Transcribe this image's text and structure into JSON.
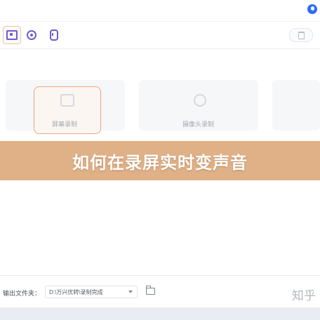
{
  "banner": {
    "title": "如何在录屏实时变声音"
  },
  "toolbar": {
    "buttons": [
      {
        "icon": "screen-record-icon",
        "active": true
      },
      {
        "icon": "webcam-icon",
        "active": false
      },
      {
        "icon": "microphone-icon",
        "active": false
      }
    ],
    "right_icon": "trash-icon"
  },
  "modes": [
    {
      "label": "屏幕录制",
      "icon": "screen-record-icon"
    },
    {
      "label": "摄像头录制",
      "icon": "webcam-icon"
    }
  ],
  "output": {
    "label": "输出文件夹：",
    "path": "D:\\万兴优转\\录制完成"
  },
  "watermark": "知乎",
  "colors": {
    "accent": "#6b5cd6",
    "banner": "#ddaa7d",
    "active_border": "#e8a77d",
    "logo": "#2f6bff"
  }
}
